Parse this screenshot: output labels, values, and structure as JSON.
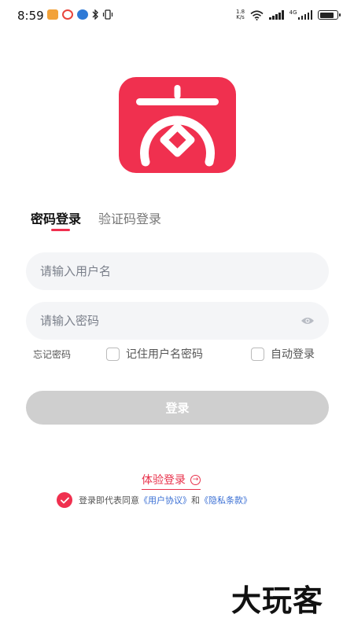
{
  "status_bar": {
    "time": "8:59",
    "net_speed_value": "1.8",
    "net_speed_unit": "K/s",
    "network_type": "4G",
    "icons": [
      "mail-icon",
      "weibo-icon",
      "app-icon",
      "bluetooth-icon",
      "vibrate-icon",
      "wifi-icon",
      "signal-icon",
      "signal-4g-icon",
      "battery-icon"
    ],
    "battery_level": 0.82
  },
  "logo": {
    "icon": "shop-logo-icon",
    "color": "#f0304f"
  },
  "tabs": [
    {
      "label": "密码登录",
      "active": true
    },
    {
      "label": "验证码登录",
      "active": false
    }
  ],
  "form": {
    "username_placeholder": "请输入用户名",
    "password_placeholder": "请输入密码",
    "forgot_password": "忘记密码",
    "remember_label": "记住用户名密码",
    "remember_checked": false,
    "auto_login_label": "自动登录",
    "auto_login_checked": false,
    "login_button": "登录"
  },
  "experience_login": "体验登录",
  "agreement": {
    "checked": true,
    "prefix": "登录即代表同意",
    "user_agreement": "《用户协议》",
    "and": "和",
    "privacy_policy": "《隐私条款》"
  },
  "watermark": "大玩客",
  "colors": {
    "accent": "#f0304f",
    "link": "#3a6fd4",
    "button_disabled": "#cfcfcf",
    "input_bg": "#f4f5f7"
  }
}
